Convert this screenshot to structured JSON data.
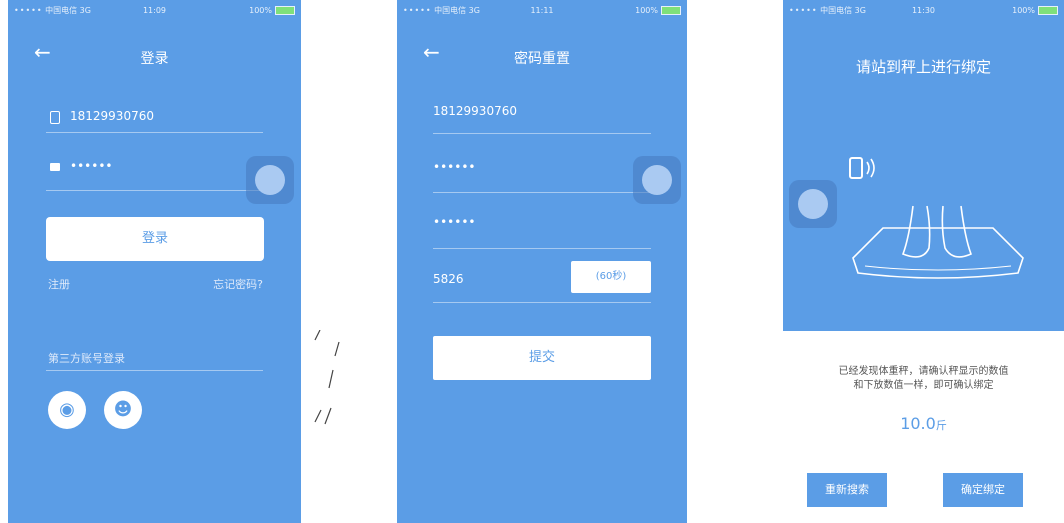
{
  "status_bar": {
    "carrier": "中国电信 3G",
    "times": [
      "11:09",
      "11:11",
      "11:30"
    ],
    "battery": "100%"
  },
  "login": {
    "title": "登录",
    "phone": "18129930760",
    "password": "••••••",
    "login_button": "登录",
    "register_link": "注册",
    "forgot_link": "忘记密码?",
    "third_party_label": "第三方账号登录",
    "icons": [
      "weibo-icon",
      "qq-icon"
    ]
  },
  "reset": {
    "title": "密码重置",
    "phone": "18129930760",
    "password": "••••••",
    "confirm_password": "••••••",
    "code": "5826",
    "code_button": "(60秒)",
    "submit_button": "提交"
  },
  "bind": {
    "title": "请站到秤上进行绑定",
    "message_line1": "已经发现体重秤，请确认秤显示的数值",
    "message_line2": "和下放数值一样，即可确认绑定",
    "weight_value": "10.0",
    "weight_unit": "斤",
    "research_button": "重新搜索",
    "confirm_button": "确定绑定"
  },
  "colors": {
    "primary": "#5b9de6",
    "white": "#ffffff"
  }
}
